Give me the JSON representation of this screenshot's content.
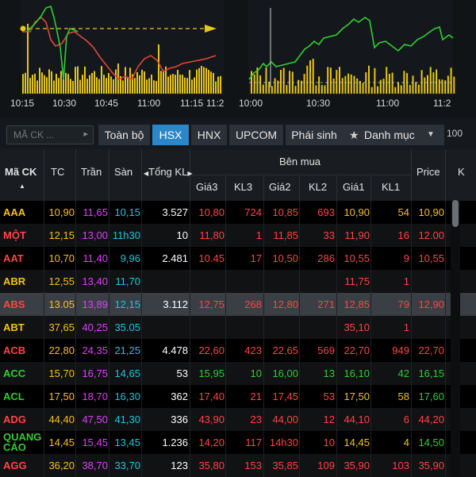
{
  "left_chart": {
    "time_ticks": [
      "10:15",
      "10:30",
      "10:45",
      "11:00",
      "11:15",
      "11:2"
    ]
  },
  "right_chart": {
    "time_ticks": [
      "10:00",
      "10:30",
      "11:00",
      "11:2"
    ]
  },
  "toolbar": {
    "search_placeholder": "MÃ CK ...",
    "tabs": [
      "Toàn bộ",
      "HSX",
      "HNX",
      "UPCOM",
      "Phái sinh",
      "Danh mục"
    ],
    "right_text": "100"
  },
  "header": {
    "ma_ck": "Mã CK",
    "tc": "TC",
    "tran": "Trần",
    "san": "Sàn",
    "tong_kl": "Tổng KL",
    "ben_mua": "Bên mua",
    "gia3": "Giá3",
    "kl3": "KL3",
    "gia2": "Giá2",
    "kl2": "KL2",
    "gia1": "Giá1",
    "kl1": "KL1",
    "price": "Price",
    "extra": "K"
  },
  "colors": {
    "ceiling": "#e040fb",
    "floor": "#1fc5dc",
    "reference": "#f3c11b",
    "down": "#ff4444",
    "up": "#33cc33",
    "white": "#ffffff"
  },
  "rows": [
    {
      "code": "AAA",
      "tc": "10,90",
      "tran": "11,65",
      "san": "10,15",
      "tkl": "3.527",
      "g3": "10,80",
      "k3": "724",
      "g2": "10,85",
      "k2": "693",
      "g1": "10,90",
      "k1": "54",
      "price": "10,90",
      "cc": "ref",
      "c3": "down",
      "c2": "down",
      "c1": "ref",
      "cp": "ref"
    },
    {
      "code": "MỘT",
      "tc": "12,15",
      "tran": "13,00",
      "san": "11h30",
      "tkl": "10",
      "g3": "11,80",
      "k3": "1",
      "g2": "11,85",
      "k2": "33",
      "g1": "11,90",
      "k1": "16",
      "price": "12.00",
      "cc": "down",
      "c3": "down",
      "c2": "down",
      "c1": "down",
      "cp": "down"
    },
    {
      "code": "AAT",
      "tc": "10,70",
      "tran": "11,40",
      "san": "9,96",
      "tkl": "2.481",
      "g3": "10.45",
      "k3": "17",
      "g2": "10,50",
      "k2": "286",
      "g1": "10,55",
      "k1": "9",
      "price": "10,55",
      "cc": "down",
      "c3": "down",
      "c2": "down",
      "c1": "down",
      "cp": "down"
    },
    {
      "code": "ABR",
      "tc": "12,55",
      "tran": "13,40",
      "san": "11,70",
      "tkl": "",
      "g3": "",
      "k3": "",
      "g2": "",
      "k2": "",
      "g1": "11,75",
      "k1": "1",
      "price": "",
      "cc": "ref",
      "c3": "down",
      "c2": "down",
      "c1": "down",
      "cp": "down"
    },
    {
      "code": "ABS",
      "tc": "13.05",
      "tran": "13,89",
      "san": "12,15",
      "tkl": "3.112",
      "g3": "12,75",
      "k3": "268",
      "g2": "12,80",
      "k2": "271",
      "g1": "12,85",
      "k1": "79",
      "price": "12,90",
      "cc": "down",
      "c3": "down",
      "c2": "down",
      "c1": "down",
      "cp": "down"
    },
    {
      "code": "ABT",
      "tc": "37,65",
      "tran": "40,25",
      "san": "35.05",
      "tkl": "",
      "g3": "",
      "k3": "",
      "g2": "",
      "k2": "",
      "g1": "35,10",
      "k1": "1",
      "price": "",
      "cc": "ref",
      "c3": "down",
      "c2": "down",
      "c1": "down",
      "cp": "down"
    },
    {
      "code": "ACB",
      "tc": "22,80",
      "tran": "24,35",
      "san": "21,25",
      "tkl": "4.478",
      "g3": "22,60",
      "k3": "423",
      "g2": "22,65",
      "k2": "569",
      "g1": "22,70",
      "k1": "949",
      "price": "22,70",
      "cc": "down",
      "c3": "down",
      "c2": "down",
      "c1": "down",
      "cp": "down"
    },
    {
      "code": "ACC",
      "tc": "15,70",
      "tran": "16,75",
      "san": "14,65",
      "tkl": "53",
      "g3": "15,95",
      "k3": "10",
      "g2": "16,00",
      "k2": "13",
      "g1": "16,10",
      "k1": "42",
      "price": "16,15",
      "cc": "up",
      "c3": "up",
      "c2": "up",
      "c1": "up",
      "cp": "up"
    },
    {
      "code": "ACL",
      "tc": "17,50",
      "tran": "18,70",
      "san": "16,30",
      "tkl": "362",
      "g3": "17,40",
      "k3": "21",
      "g2": "17,45",
      "k2": "53",
      "g1": "17,50",
      "k1": "58",
      "price": "17,60",
      "cc": "up",
      "c3": "down",
      "c2": "down",
      "c1": "ref",
      "cp": "up"
    },
    {
      "code": "ADG",
      "tc": "44,40",
      "tran": "47,50",
      "san": "41,30",
      "tkl": "336",
      "g3": "43,90",
      "k3": "23",
      "g2": "44,00",
      "k2": "12",
      "g1": "44,10",
      "k1": "6",
      "price": "44,20",
      "cc": "down",
      "c3": "down",
      "c2": "down",
      "c1": "down",
      "cp": "down"
    },
    {
      "code": "QUANG CÁO",
      "tc": "14,45",
      "tran": "15,45",
      "san": "13,45",
      "tkl": "1.236",
      "g3": "14,20",
      "k3": "117",
      "g2": "14h30",
      "k2": "10",
      "g1": "14,45",
      "k1": "4",
      "price": "14,50",
      "cc": "up",
      "c3": "down",
      "c2": "down",
      "c1": "ref",
      "cp": "up"
    },
    {
      "code": "AGG",
      "tc": "36,20",
      "tran": "38,70",
      "san": "33,70",
      "tkl": "123",
      "g3": "35,80",
      "k3": "153",
      "g2": "35,85",
      "k2": "109",
      "g1": "35,90",
      "k1": "103",
      "price": "35,90",
      "cc": "down",
      "c3": "down",
      "c2": "down",
      "c1": "down",
      "cp": "down"
    }
  ]
}
